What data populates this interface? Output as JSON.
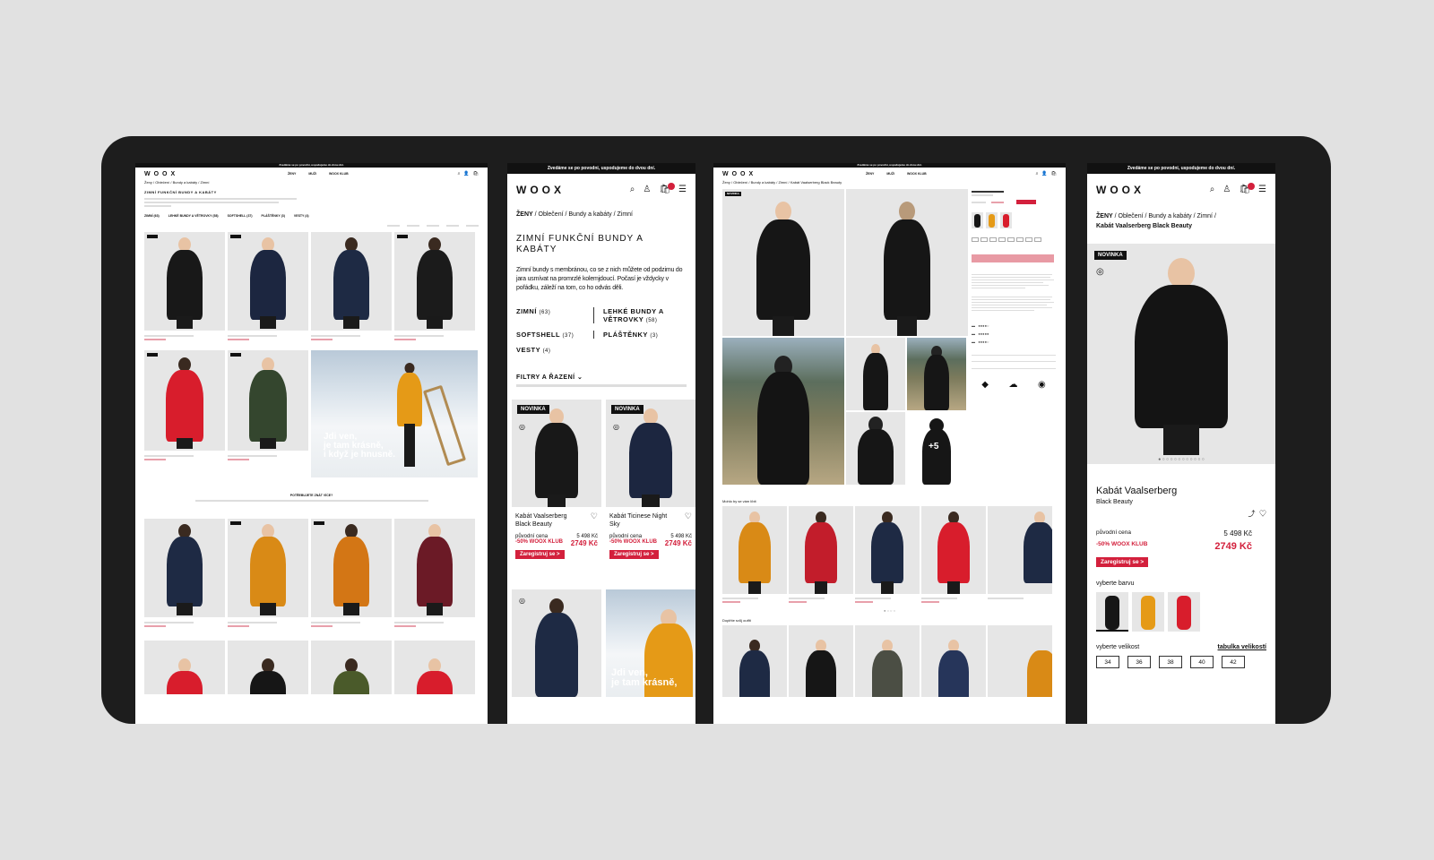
{
  "brand": "WOOX",
  "promo": "Zvedáme se po povodni, uspodujeme do dvou dní.",
  "p1": {
    "nav": [
      "ŽENY",
      "MUŽI",
      "WOOX KLUB"
    ],
    "breadcrumb": "Ženy / Oblečení / Bundy a kabáty / Zimní",
    "title": "ZIMNÍ FUNKČNÍ BUNDY A KABÁTY",
    "cats": [
      "ZIMNÍ (63)",
      "LEHKÉ BUNDY A VĚTROVKY (58)",
      "SOFTSHELL (37)",
      "PLÁŠTĚNKY (3)",
      "VESTY (4)"
    ],
    "banner": "Jdi ven,\nje tam krásně,\ni když je hnusně.",
    "mid_title": "POTŘEBUJETE ZNÁT VÍCE?"
  },
  "p2": {
    "breadcrumb": [
      "ŽENY",
      "Oblečení",
      "Bundy a kabáty",
      "Zimní"
    ],
    "title": "ZIMNÍ FUNKČNÍ BUNDY A KABÁTY",
    "desc": "Zimní bundy s membránou, co se z nich můžete od podzimu do jara usmívat na promrzlé kolemjdoucí. Počasí je vždycky v pořádku, záleží na tom, co ho odvás děli.",
    "cats": [
      {
        "name": "ZIMNÍ",
        "count": "(63)"
      },
      {
        "name": "LEHKÉ BUNDY A VĚTROVKY",
        "count": "(58)"
      },
      {
        "name": "SOFTSHELL",
        "count": "(37)"
      },
      {
        "name": "PLÁŠTĚNKY",
        "count": "(3)"
      },
      {
        "name": "VESTY",
        "count": "(4)"
      }
    ],
    "filters": "FILTRY A ŘAZENÍ",
    "badge": "NOVINKA",
    "products": [
      {
        "name": "Kabát Vaalserberg Black Beauty",
        "orig_label": "původní cena",
        "orig": "5 498 Kč",
        "club": "-50% WOOX KLUB",
        "price": "2749 Kč",
        "cta": "Zaregistruj se >"
      },
      {
        "name": "Kabát Ticinese Night Sky",
        "orig_label": "původní cena",
        "orig": "5 498 Kč",
        "club": "-50% WOOX KLUB",
        "price": "2749 Kč",
        "cta": "Zaregistruj se >"
      }
    ],
    "banner": "Jdi ven,\nje tam krásně,"
  },
  "p3": {
    "breadcrumb": "Ženy / Oblečení / Bundy a kabáty / Zimní / Kabát Vaalserberg Black Beauty",
    "badge": "NOVINKA",
    "more": "+5",
    "section1": "Mohlo by se vám líbit",
    "section2": "Doplňte svůj outfit"
  },
  "p4": {
    "breadcrumb": [
      "ŽENY",
      "Oblečení",
      "Bundy a kabáty",
      "Zimní"
    ],
    "breadcrumb2": "Kabát Vaalserberg Black Beauty",
    "badge": "NOVINKA",
    "name": "Kabát Vaalserberg",
    "subname": "Black Beauty",
    "orig_label": "původní cena",
    "orig": "5 498 Kč",
    "club": "-50% WOOX KLUB",
    "price": "2749 Kč",
    "cta": "Zaregistruj se >",
    "color_label": "vyberte barvu",
    "size_label": "vyberte velikost",
    "size_table": "tabulka velikostí",
    "sizes": [
      "34",
      "36",
      "38",
      "40",
      "42"
    ]
  },
  "colors": {
    "accent": "#d3203c",
    "dark": "#111111",
    "frame": "#1d1d1d",
    "bg": "#e1e1e1"
  }
}
